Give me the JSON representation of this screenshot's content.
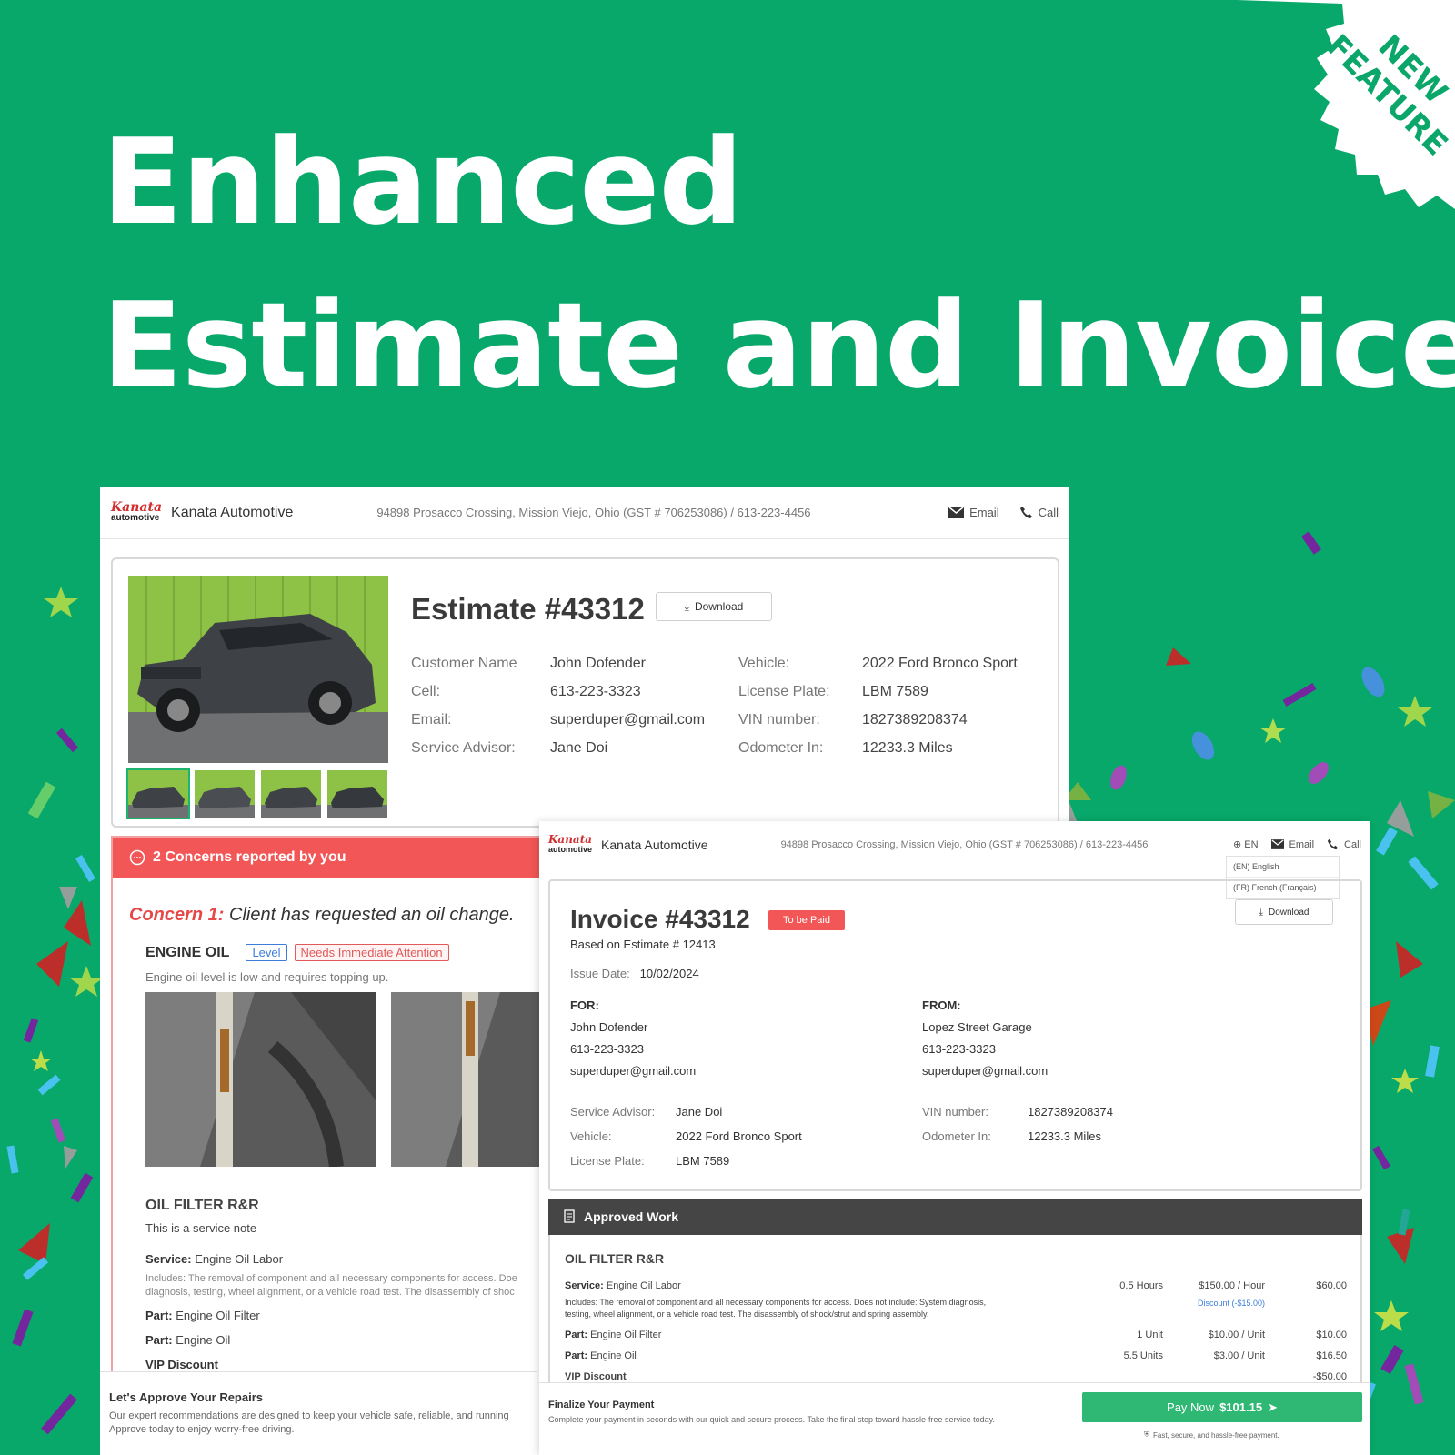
{
  "hero": {
    "line1": "Enhanced",
    "line2": "Estimate and Invoice",
    "badge_line1": "NEW",
    "badge_line2": "FEATURE"
  },
  "colors": {
    "background": "#08a86a",
    "accent_red": "#f25656",
    "pay_green": "#2fb873",
    "approved_dark": "#454545"
  },
  "estimate_page": {
    "logo_line1": "Kanata",
    "logo_line2": "automotive",
    "business_name": "Kanata Automotive",
    "address": "94898 Prosacco Crossing, Mission Viejo, Ohio (GST # 706253086)  / 613-223-4456",
    "email_label": "Email",
    "call_label": "Call",
    "title": "Estimate #43312",
    "download_label": "Download",
    "customer": {
      "name_label": "Customer Name",
      "name": "John Dofender",
      "cell_label": "Cell:",
      "cell": "613-223-3323",
      "email_label": "Email:",
      "email": "superduper@gmail.com",
      "advisor_label": "Service Advisor:",
      "advisor": "Jane Doi"
    },
    "vehicle": {
      "vehicle_label": "Vehicle:",
      "vehicle": "2022 Ford Bronco Sport",
      "plate_label": "License Plate:",
      "plate": "LBM 7589",
      "vin_label": "VIN number:",
      "vin": "1827389208374",
      "odometer_label": "Odometer In:",
      "odometer": "12233.3 Miles"
    },
    "concerns_header": "2 Concerns reported by you",
    "concern_prefix": "Concern 1:",
    "concern_text": "Client has requested an oil change.",
    "engine_oil": "ENGINE OIL",
    "tag_level": "Level",
    "tag_attention": "Needs Immediate Attention",
    "engine_note": "Engine oil level is low and requires topping up.",
    "oil_filter": "OIL FILTER R&R",
    "service_note": "This is a service note",
    "service_label": "Service:",
    "service_value": "Engine Oil Labor",
    "includes_1": "Includes: The removal of component and all necessary components for access. Doe",
    "includes_2": "diagnosis, testing, wheel alignment, or a vehicle road test. The disassembly of shoc",
    "part_label": "Part:",
    "part1": "Engine Oil Filter",
    "part2": "Engine Oil",
    "vip": "VIP Discount",
    "approve_title": "Let's Approve Your Repairs",
    "approve_text_1": "Our expert recommendations are designed to keep your vehicle safe, reliable, and running",
    "approve_text_2": "Approve today to enjoy worry-free driving."
  },
  "invoice_page": {
    "logo_line1": "Kanata",
    "logo_line2": "automotive",
    "business_name": "Kanata Automotive",
    "address": "94898 Prosacco Crossing, Mission Viejo, Ohio (GST # 706253086)  / 613-223-4456",
    "lang_label": "EN",
    "email_label": "Email",
    "call_label": "Call",
    "lang_options": [
      "(EN) English",
      "(FR) French (Français)"
    ],
    "title": "Invoice #43312",
    "status": "To be Paid",
    "download_label": "Download",
    "based_on": "Based on Estimate # 12413",
    "issue_label": "Issue Date:",
    "issue_date": "10/02/2024",
    "for_label": "FOR:",
    "for_name": "John Dofender",
    "for_phone": "613-223-3323",
    "for_email": "superduper@gmail.com",
    "from_label": "FROM:",
    "from_name": "Lopez Street Garage",
    "from_phone": "613-223-3323",
    "from_email": "superduper@gmail.com",
    "advisor_label": "Service Advisor:",
    "advisor": "Jane Doi",
    "vehicle_label": "Vehicle:",
    "vehicle": "2022 Ford Bronco Sport",
    "plate_label": "License Plate:",
    "plate": "LBM 7589",
    "vin_label": "VIN number:",
    "vin": "1827389208374",
    "odometer_label": "Odometer In:",
    "odometer": "12233.3 Miles",
    "approved_work": "Approved Work",
    "oil_filter": "OIL FILTER R&R",
    "service_label": "Service:",
    "service_value": "Engine Oil Labor",
    "service_qty": "0.5 Hours",
    "service_rate": "$150.00 / Hour",
    "service_total": "$60.00",
    "discount": "Discount (-$15.00)",
    "includes_1": "Includes: The removal of component and all necessary components for access. Does not include: System diagnosis,",
    "includes_2": "testing, wheel alignment, or a vehicle road test. The disassembly of shock/strut and spring assembly.",
    "part_label": "Part:",
    "part1": "Engine Oil Filter",
    "part1_qty": "1 Unit",
    "part1_rate": "$10.00 / Unit",
    "part1_total": "$10.00",
    "part2": "Engine Oil",
    "part2_qty": "5.5 Units",
    "part2_rate": "$3.00 / Unit",
    "part2_total": "$16.50",
    "vip": "VIP Discount",
    "vip_total": "-$50.00",
    "finalize_title": "Finalize Your Payment",
    "finalize_text": "Complete your payment in seconds with our quick and secure process. Take the final step toward hassle-free service today.",
    "pay_label": "Pay Now",
    "pay_amount": "$101.15",
    "secure_note": "Fast, secure, and hassle-free payment."
  }
}
